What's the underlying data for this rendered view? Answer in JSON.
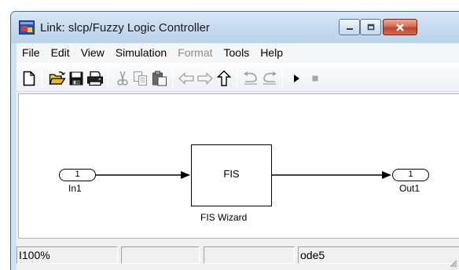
{
  "window": {
    "title": "Link: slcp/Fuzzy Logic Controller",
    "title_icon": "simulink-model-icon"
  },
  "menu": [
    {
      "label": "File",
      "enabled": true
    },
    {
      "label": "Edit",
      "enabled": true
    },
    {
      "label": "View",
      "enabled": true
    },
    {
      "label": "Simulation",
      "enabled": true
    },
    {
      "label": "Format",
      "enabled": false
    },
    {
      "label": "Tools",
      "enabled": true
    },
    {
      "label": "Help",
      "enabled": true
    }
  ],
  "toolbar": {
    "icons": [
      "new-icon",
      "open-icon",
      "save-icon",
      "print-icon",
      "cut-icon",
      "copy-icon",
      "paste-icon",
      "back-icon",
      "forward-icon",
      "up-icon",
      "undo-icon",
      "redo-icon",
      "play-icon",
      "stop-icon"
    ]
  },
  "diagram": {
    "inport": {
      "number": "1",
      "label": "In1"
    },
    "block": {
      "text": "FIS",
      "name": "FIS Wizard"
    },
    "outport": {
      "number": "1",
      "label": "Out1"
    }
  },
  "status": {
    "left_fragment": "I",
    "zoom": "100%",
    "segment2": "",
    "segment3": "",
    "solver": "ode5"
  }
}
